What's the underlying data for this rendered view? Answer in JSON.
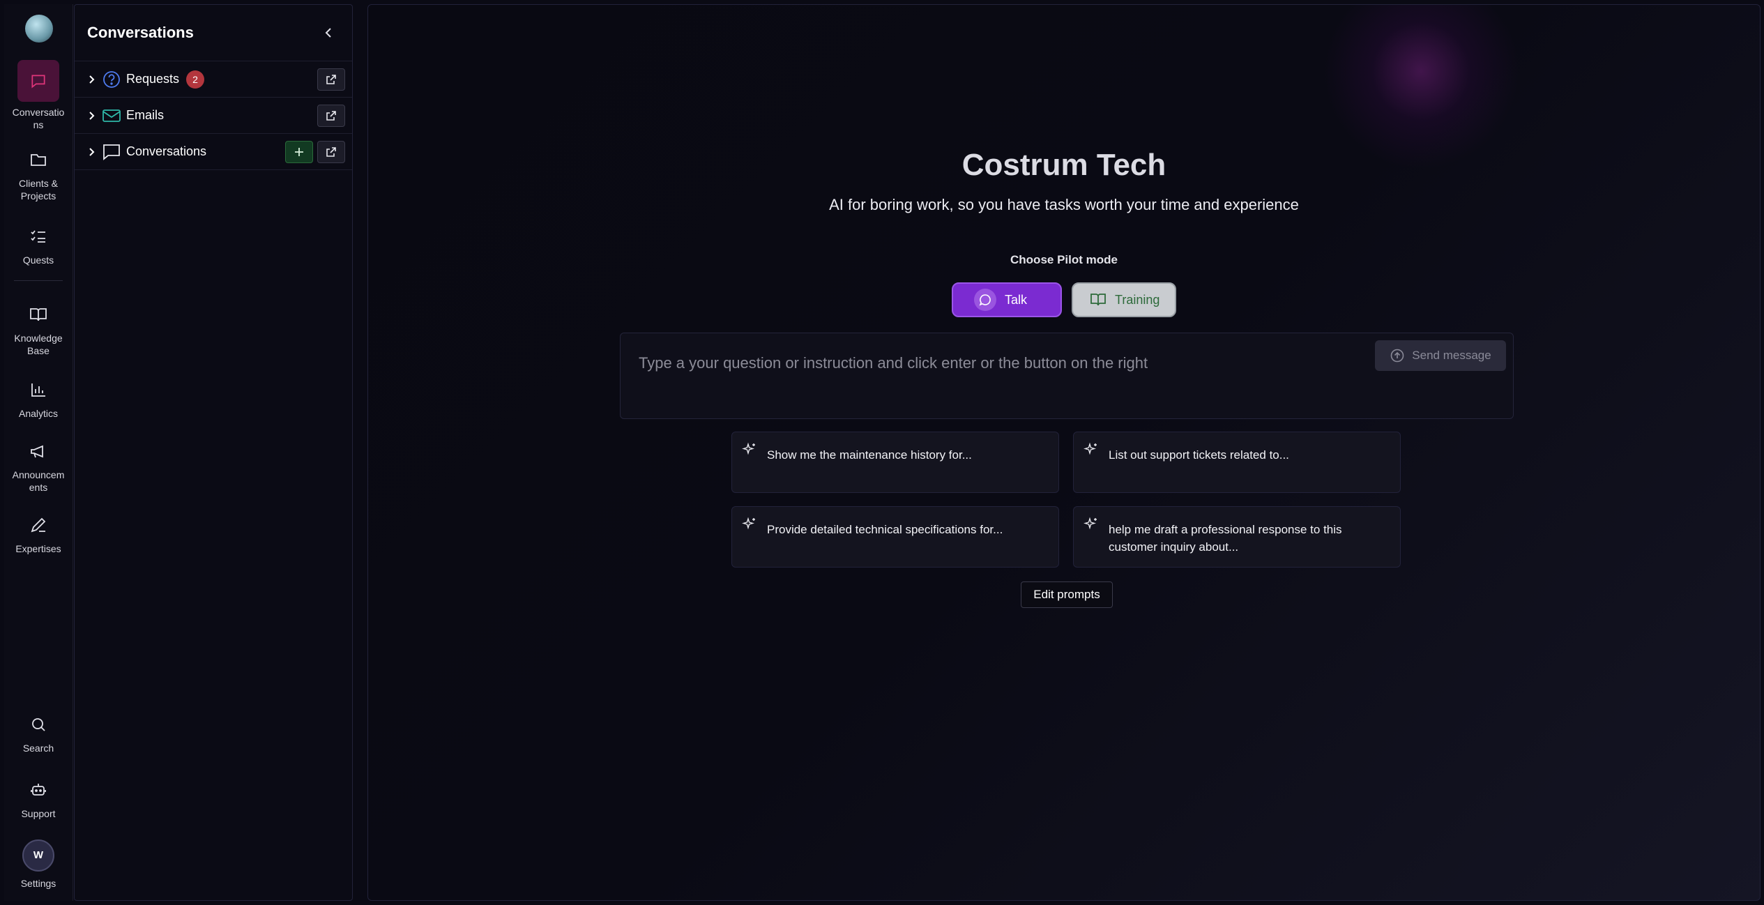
{
  "rail": {
    "items": [
      {
        "label": "Conversations"
      },
      {
        "label": "Clients & Projects"
      },
      {
        "label": "Quests"
      },
      {
        "label": "Knowledge Base"
      },
      {
        "label": "Analytics"
      },
      {
        "label": "Announcements"
      },
      {
        "label": "Expertises"
      }
    ],
    "bottom": [
      {
        "label": "Search"
      },
      {
        "label": "Support"
      },
      {
        "label": "Settings",
        "avatar_initial": "W"
      }
    ]
  },
  "panel": {
    "title": "Conversations",
    "rows": [
      {
        "label": "Requests",
        "badge": "2"
      },
      {
        "label": "Emails"
      },
      {
        "label": "Conversations"
      }
    ]
  },
  "main": {
    "title": "Costrum Tech",
    "subtitle": "AI for boring work, so you have tasks worth your time and experience",
    "mode_label": "Choose Pilot mode",
    "modes": {
      "talk": "Talk",
      "training": "Training"
    },
    "chat": {
      "placeholder": "Type a your question or instruction and click enter or the button on the right",
      "send_label": "Send message"
    },
    "prompts": [
      "Show me the maintenance history for...",
      "List out support tickets related to...",
      "Provide detailed technical specifications for...",
      "help me draft a professional response to this customer inquiry about..."
    ],
    "edit_prompts": "Edit prompts"
  },
  "colors": {
    "accent_purple": "#7b2bd1",
    "badge_red": "#b3363d",
    "active_rail": "#4a1238"
  }
}
